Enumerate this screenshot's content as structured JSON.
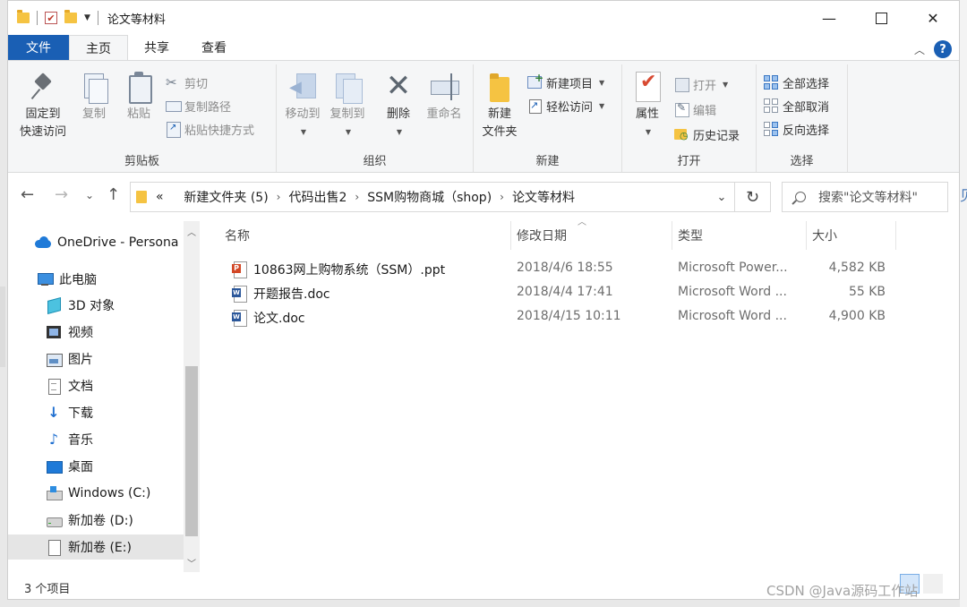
{
  "window": {
    "title": "论文等材料"
  },
  "tabs": [
    {
      "label": "文件"
    },
    {
      "label": "主页"
    },
    {
      "label": "共享"
    },
    {
      "label": "查看"
    }
  ],
  "ribbon": {
    "clipboard": {
      "label": "剪贴板",
      "pin": "固定到\n快速访问",
      "pin_line1": "固定到",
      "pin_line2": "快速访问",
      "copy": "复制",
      "paste": "粘贴",
      "cut": "剪切",
      "copy_path": "复制路径",
      "paste_shortcut": "粘贴快捷方式"
    },
    "organize": {
      "label": "组织",
      "move_to": "移动到",
      "copy_to": "复制到",
      "delete": "删除",
      "rename": "重命名"
    },
    "new": {
      "label": "新建",
      "new_folder_line1": "新建",
      "new_folder_line2": "文件夹",
      "new_item": "新建项目",
      "easy_access": "轻松访问"
    },
    "open": {
      "label": "打开",
      "properties": "属性",
      "open": "打开",
      "edit": "编辑",
      "history": "历史记录"
    },
    "select": {
      "label": "选择",
      "select_all": "全部选择",
      "select_none": "全部取消",
      "invert": "反向选择"
    }
  },
  "address": {
    "overflow": "«",
    "crumbs": [
      "新建文件夹 (5)",
      "代码出售2",
      "SSM购物商城（shop)",
      "论文等材料"
    ]
  },
  "search": {
    "placeholder": "搜索\"论文等材料\""
  },
  "sidebar": {
    "items": [
      {
        "label": "OneDrive - Persona",
        "icon": "onedrive-icon"
      },
      {
        "label": "此电脑",
        "icon": "this-pc-icon"
      },
      {
        "label": "3D 对象",
        "icon": "3d-objects-icon"
      },
      {
        "label": "视频",
        "icon": "videos-icon"
      },
      {
        "label": "图片",
        "icon": "pictures-icon"
      },
      {
        "label": "文档",
        "icon": "documents-icon"
      },
      {
        "label": "下载",
        "icon": "downloads-icon"
      },
      {
        "label": "音乐",
        "icon": "music-icon"
      },
      {
        "label": "桌面",
        "icon": "desktop-icon"
      },
      {
        "label": "Windows (C:)",
        "icon": "drive-c-icon"
      },
      {
        "label": "新加卷 (D:)",
        "icon": "drive-d-icon"
      },
      {
        "label": "新加卷 (E:)",
        "icon": "drive-e-icon"
      }
    ]
  },
  "columns": {
    "name": "名称",
    "date": "修改日期",
    "type": "类型",
    "size": "大小"
  },
  "files": [
    {
      "name": "10863网上购物系统（SSM）.ppt",
      "date": "2018/4/6 18:55",
      "type": "Microsoft Power...",
      "size": "4,582 KB",
      "icon": "ppt-file-icon"
    },
    {
      "name": "开题报告.doc",
      "date": "2018/4/4 17:41",
      "type": "Microsoft Word ...",
      "size": "55 KB",
      "icon": "word-file-icon"
    },
    {
      "name": "论文.doc",
      "date": "2018/4/15 10:11",
      "type": "Microsoft Word ...",
      "size": "4,900 KB",
      "icon": "word-file-icon"
    }
  ],
  "status": {
    "count": "3 个项目"
  },
  "watermark": "CSDN @Java源码工作站"
}
